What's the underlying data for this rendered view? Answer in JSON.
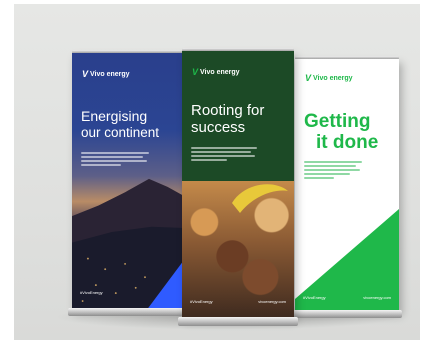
{
  "banners": [
    {
      "logo_mark": "V",
      "logo_text": "Vivo energy",
      "headline_line1": "Energising",
      "headline_line2": "our continent",
      "footer_left": "#VivoEnergy",
      "footer_right": "vivoenergy.com",
      "colors": {
        "background": "#2b4593",
        "accent": "#2f5bff",
        "text": "#ffffff"
      }
    },
    {
      "logo_mark": "V",
      "logo_text": "Vivo energy",
      "headline_line1": "Rooting for",
      "headline_line2": "success",
      "footer_left": "#VivoEnergy",
      "footer_right": "vivoenergy.com",
      "colors": {
        "background": "#1c4a26",
        "accent": "#e8c93a",
        "text": "#ffffff"
      }
    },
    {
      "logo_mark": "V",
      "logo_text": "Vivo energy",
      "headline_line1": "Getting",
      "headline_line2": "it done",
      "footer_left": "#VivoEnergy",
      "footer_right": "vivoenergy.com",
      "colors": {
        "background": "#ffffff",
        "accent": "#1fb84a",
        "text": "#1fb84a"
      }
    }
  ]
}
